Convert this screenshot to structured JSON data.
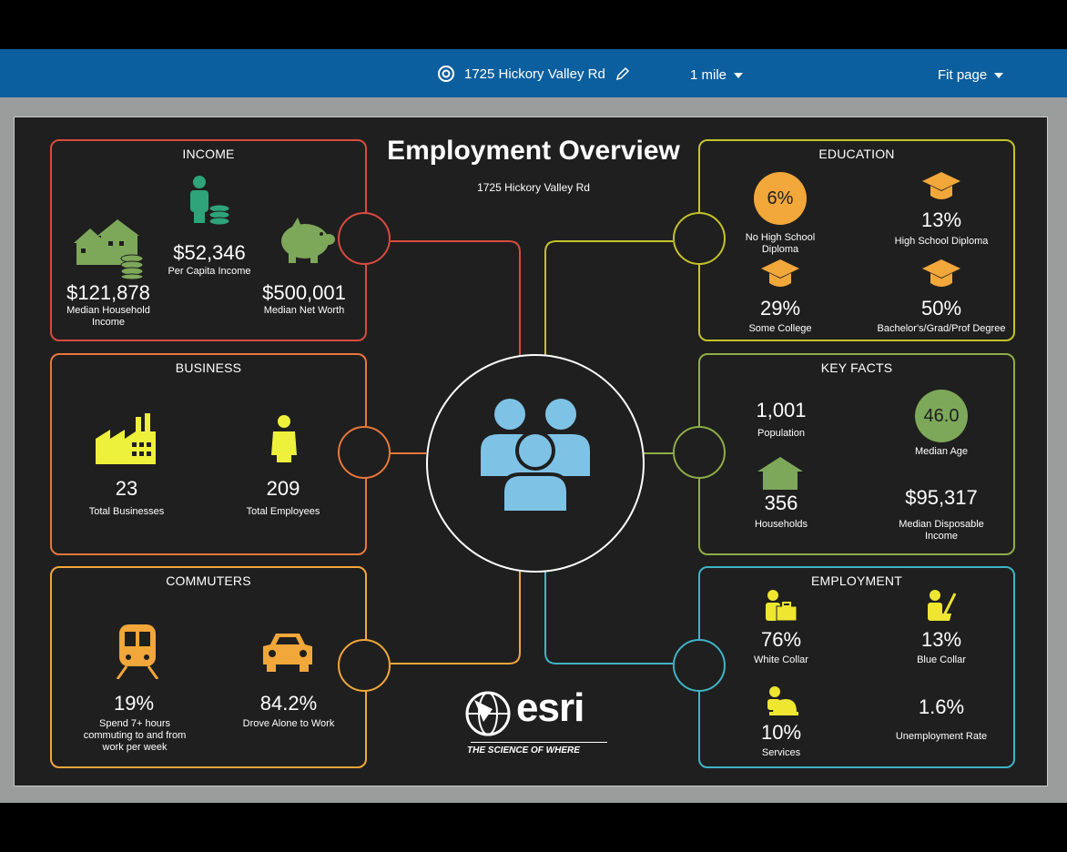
{
  "topbar": {
    "address": "1725 Hickory Valley Rd",
    "radius": "1 mile",
    "fit": "Fit page"
  },
  "infographic": {
    "title": "Employment Overview",
    "subtitle": "1725 Hickory Valley Rd",
    "income": {
      "title": "INCOME",
      "median_household_income": "$121,878",
      "median_household_income_label": "Median Household Income",
      "per_capita_income": "$52,346",
      "per_capita_income_label": "Per Capita Income",
      "median_net_worth": "$500,001",
      "median_net_worth_label": "Median Net Worth"
    },
    "business": {
      "title": "BUSINESS",
      "total_businesses": "23",
      "total_businesses_label": "Total Businesses",
      "total_employees": "209",
      "total_employees_label": "Total Employees"
    },
    "commuters": {
      "title": "COMMUTERS",
      "long_commute": "19%",
      "long_commute_label": "Spend 7+ hours commuting to and from work per week",
      "drove_alone": "84.2%",
      "drove_alone_label": "Drove Alone to Work"
    },
    "education": {
      "title": "EDUCATION",
      "no_hs": "6%",
      "no_hs_label": "No High School Diploma",
      "hs": "13%",
      "hs_label": "High School Diploma",
      "some_college": "29%",
      "some_college_label": "Some College",
      "bachelors": "50%",
      "bachelors_label": "Bachelor's/Grad/Prof Degree"
    },
    "key_facts": {
      "title": "KEY FACTS",
      "population": "1,001",
      "population_label": "Population",
      "median_age": "46.0",
      "median_age_label": "Median Age",
      "households": "356",
      "households_label": "Households",
      "disposable_income": "$95,317",
      "disposable_income_label": "Median Disposable Income"
    },
    "employment": {
      "title": "EMPLOYMENT",
      "white_collar": "76%",
      "white_collar_label": "White Collar",
      "blue_collar": "13%",
      "blue_collar_label": "Blue Collar",
      "services": "10%",
      "services_label": "Services",
      "unemployment": "1.6%",
      "unemployment_label": "Unemployment Rate"
    },
    "logo": {
      "wordmark": "esri",
      "tagline": "THE SCIENCE OF WHERE"
    }
  },
  "colors": {
    "income": "#d94b3f",
    "business": "#e8773b",
    "commuters": "#f2a73a",
    "education": "#c6c22a",
    "key_facts": "#8fad45",
    "employment": "#3fb4c6",
    "income_icons": "#7da85a",
    "business_icons": "#eef13c",
    "education_icons": "#f2a73a",
    "employment_icons": "#eee631"
  },
  "icons": [
    "target-icon",
    "pencil-icon",
    "chevron-down-icon",
    "house-icon",
    "coin-stack-icon",
    "person-icon",
    "piggy-bank-icon",
    "factory-icon",
    "train-icon",
    "car-icon",
    "graduation-cap-icon",
    "briefcase-icon",
    "broom-icon",
    "bell-icon",
    "people-icon",
    "globe-icon"
  ]
}
